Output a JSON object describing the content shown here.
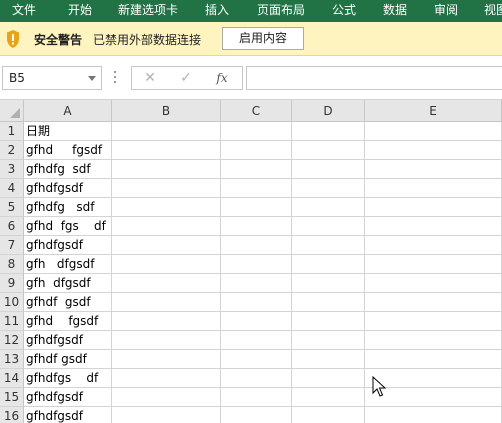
{
  "ribbon": {
    "tabs": [
      "文件",
      "开始",
      "新建选项卡",
      "插入",
      "页面布局",
      "公式",
      "数据",
      "审阅",
      "视图"
    ]
  },
  "security_bar": {
    "title": "安全警告",
    "message": "已禁用外部数据连接",
    "button_label": "启用内容"
  },
  "formula_bar": {
    "name_box": "B5",
    "cancel_symbol": "✕",
    "enter_symbol": "✓",
    "fx_symbol": "fx",
    "formula": ""
  },
  "sheet": {
    "columns": [
      "A",
      "B",
      "C",
      "D",
      "E"
    ],
    "rows": [
      {
        "num": "1",
        "a": "日期"
      },
      {
        "num": "2",
        "a": "gfhd     fgsdf"
      },
      {
        "num": "3",
        "a": "gfhdfg  sdf"
      },
      {
        "num": "4",
        "a": "gfhdfgsdf"
      },
      {
        "num": "5",
        "a": "gfhdfg   sdf"
      },
      {
        "num": "6",
        "a": "gfhd  fgs    df"
      },
      {
        "num": "7",
        "a": "gfhdfgsdf"
      },
      {
        "num": "8",
        "a": "gfh   dfgsdf"
      },
      {
        "num": "9",
        "a": "gfh  dfgsdf"
      },
      {
        "num": "10",
        "a": "gfhdf  gsdf"
      },
      {
        "num": "11",
        "a": "gfhd    fgsdf"
      },
      {
        "num": "12",
        "a": "gfhdfgsdf"
      },
      {
        "num": "13",
        "a": "gfhdf gsdf"
      },
      {
        "num": "14",
        "a": "gfhdfgs    df"
      },
      {
        "num": "15",
        "a": "gfhdfgsdf"
      },
      {
        "num": "16",
        "a": "gfhdfgsdf"
      }
    ]
  },
  "colors": {
    "ribbon": "#217346",
    "security_bar": "#fdf4bf",
    "shield": "#e8a317"
  }
}
